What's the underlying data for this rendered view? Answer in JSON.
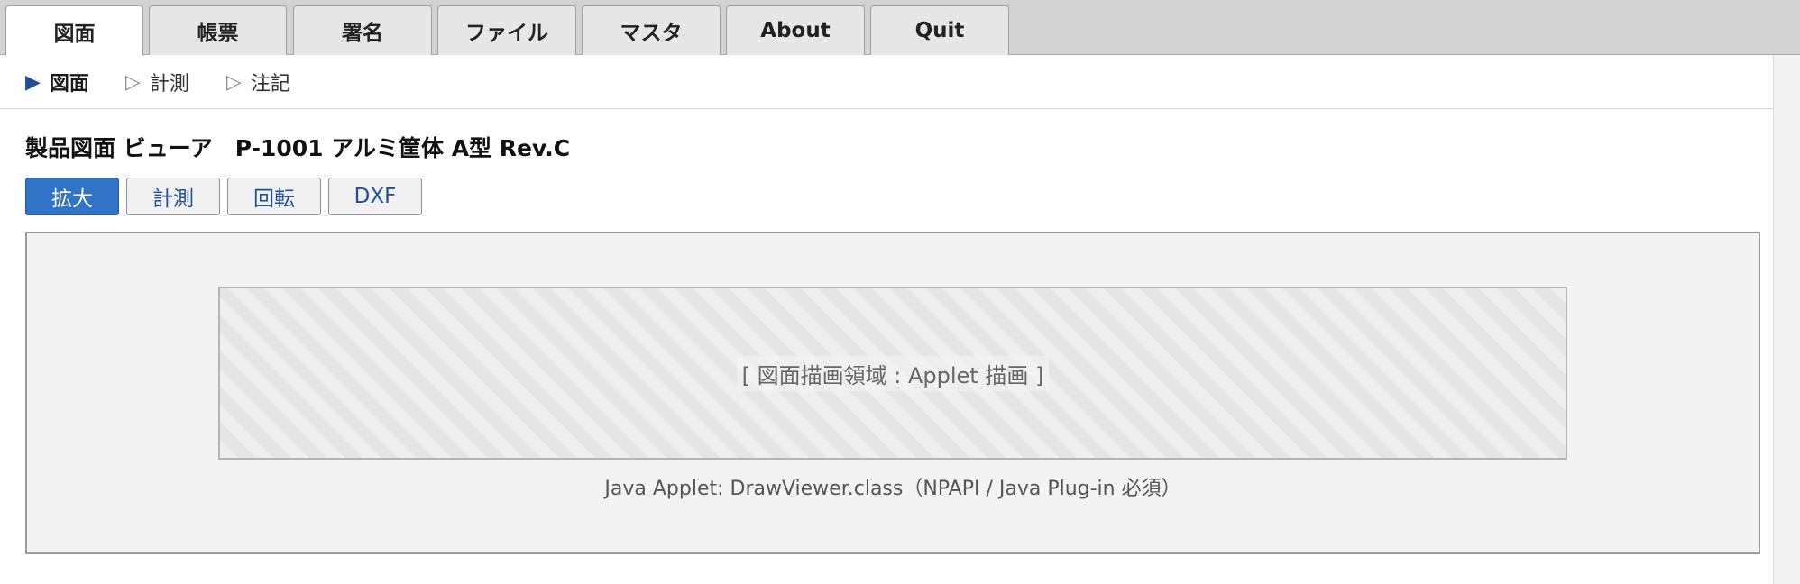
{
  "tabs": [
    {
      "label": "図面",
      "active": true
    },
    {
      "label": "帳票"
    },
    {
      "label": "署名"
    },
    {
      "label": "ファイル"
    },
    {
      "label": "マスタ"
    },
    {
      "label": "About"
    },
    {
      "label": "Quit"
    }
  ],
  "subnav": {
    "items": [
      {
        "icon": "triangle-right-filled-icon",
        "glyph": "▶",
        "label": "図面",
        "active": true
      },
      {
        "icon": "triangle-right-outline-icon",
        "glyph": "▷",
        "label": "計測"
      },
      {
        "icon": "triangle-right-outline-icon",
        "glyph": "▷",
        "label": "注記"
      }
    ]
  },
  "viewer": {
    "title": "製品図面 ビューア　P-1001 アルミ筐体 A型 Rev.C"
  },
  "toolbar": {
    "buttons": [
      {
        "label": "拡大",
        "primary": true
      },
      {
        "label": "計測"
      },
      {
        "label": "回転"
      },
      {
        "label": "DXF"
      }
    ]
  },
  "applet": {
    "canvas_label": "[ 図面描画領域 : Applet 描画 ]",
    "note": "Java Applet: DrawViewer.class（NPAPI / Java Plug-in 必須）"
  },
  "colors": {
    "accent": "#3173c7",
    "tab_bar": "#d3d3d3",
    "link": "#1f4f99"
  }
}
